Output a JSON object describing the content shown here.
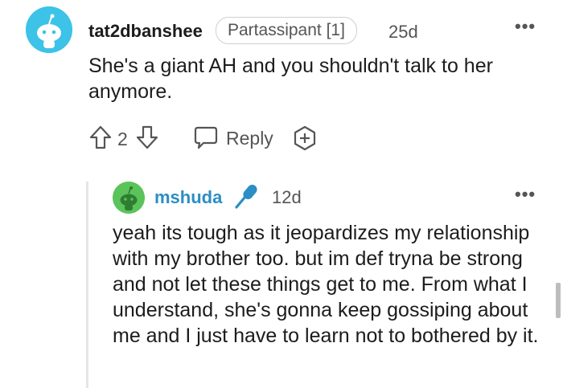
{
  "comment": {
    "username": "tat2dbanshee",
    "flair": "Partassipant [1]",
    "age": "25d",
    "more_icon": "more-horizontal-icon",
    "body": "She's a giant AH and you shouldn't talk to her anymore.",
    "vote_count": "2",
    "reply_label": "Reply",
    "avatar_color": "#3dc2e8"
  },
  "reply": {
    "username": "mshuda",
    "age": "12d",
    "username_color": "#2b8ec4",
    "avatar_color": "#5ac45a",
    "badge_icon": "microphone-icon",
    "more_icon": "more-horizontal-icon",
    "body": "yeah its tough as it jeopardizes my relationship with my brother too. but im def tryna be strong and not let these things get to me. From what I understand, she's gonna keep gossiping about me and I just have to learn not to bothered by it."
  }
}
